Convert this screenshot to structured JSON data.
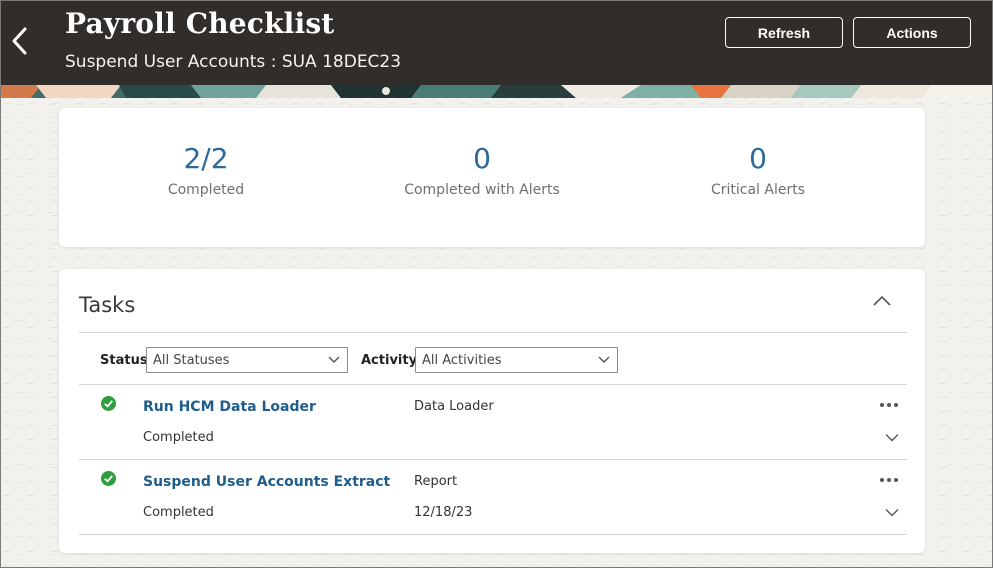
{
  "header": {
    "title": "Payroll Checklist",
    "subtitle": "Suspend User Accounts : SUA 18DEC23",
    "back_icon": "chevron-left-icon",
    "refresh_label": "Refresh",
    "actions_label": "Actions",
    "background": "#312d2a"
  },
  "summary": {
    "metrics": [
      {
        "value": "2/2",
        "label": "Completed"
      },
      {
        "value": "0",
        "label": "Completed with Alerts"
      },
      {
        "value": "0",
        "label": "Critical Alerts"
      }
    ],
    "value_color": "#2d6a9a"
  },
  "tasks": {
    "title": "Tasks",
    "collapse_icon": "chevron-up-icon",
    "filters": {
      "status_label": "Status",
      "status_value": "All Statuses",
      "activity_label": "Activity",
      "activity_value": "All Activities"
    },
    "rows": [
      {
        "name": "Run HCM Data Loader",
        "status": "Completed",
        "type": "Data Loader",
        "date": "",
        "status_icon": "check-circle-icon"
      },
      {
        "name": "Suspend User Accounts Extract",
        "status": "Completed",
        "type": "Report",
        "date": "12/18/23",
        "status_icon": "check-circle-icon"
      }
    ],
    "link_color": "#1f5d8c",
    "success_color": "#2e9d3f"
  }
}
